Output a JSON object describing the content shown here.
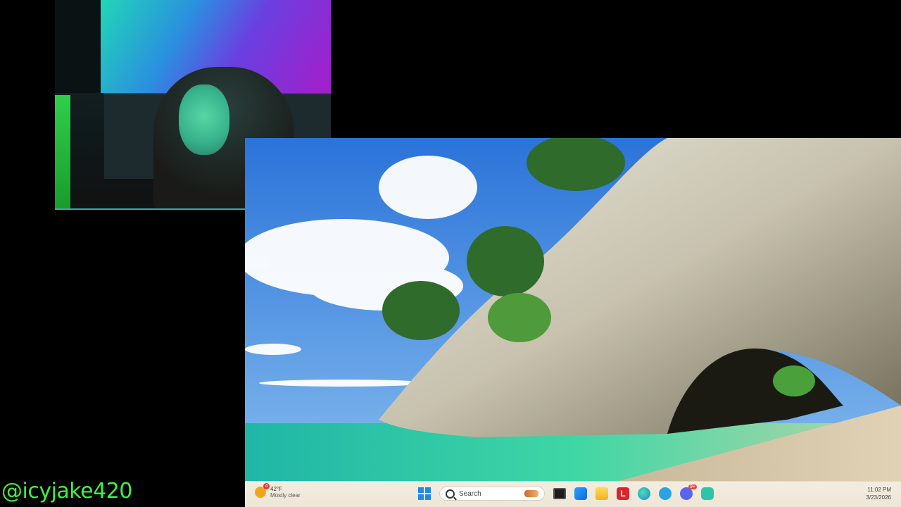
{
  "stream_overlay": {
    "handle": "@icyjake420"
  },
  "taskbar": {
    "weather": {
      "temperature": "42°F",
      "condition": "Mostly clear",
      "alert_count": "4"
    },
    "search_placeholder": "Search",
    "pinned_apps": [
      {
        "name": "start",
        "icon": "windows-logo-icon"
      },
      {
        "name": "search",
        "icon": "search-icon"
      },
      {
        "name": "task-view",
        "icon": "task-view-icon"
      },
      {
        "name": "store",
        "icon": "store-icon"
      },
      {
        "name": "file-explorer",
        "icon": "folder-icon"
      },
      {
        "name": "app-l",
        "icon": "l-app-icon",
        "label": "L"
      },
      {
        "name": "edge",
        "icon": "edge-icon"
      },
      {
        "name": "telegram",
        "icon": "telegram-icon"
      },
      {
        "name": "discord",
        "icon": "discord-icon",
        "badge": "9+"
      },
      {
        "name": "app",
        "icon": "app-icon"
      }
    ],
    "clock": {
      "time": "11:02 PM",
      "date": "3/23/2026"
    }
  },
  "colors": {
    "handle_green": "#3ef23e",
    "taskbar_bg": "#f3ede1",
    "accent_blue": "#1e8ae6"
  }
}
